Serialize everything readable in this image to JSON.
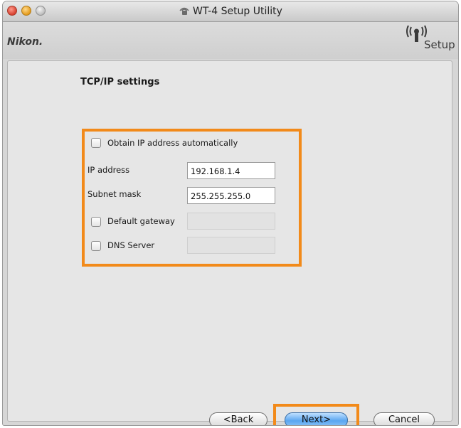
{
  "window": {
    "title": "WT-4 Setup Utility"
  },
  "brand": {
    "logo": "Nikon.",
    "setup_logo": "Setup"
  },
  "page": {
    "heading": "TCP/IP settings"
  },
  "form": {
    "obtain_auto_label": "Obtain IP address automatically",
    "ip_label": "IP address",
    "ip_value": "192.168.1.4",
    "subnet_label": "Subnet mask",
    "subnet_value": "255.255.255.0",
    "gateway_label": "Default gateway",
    "gateway_value": "",
    "dns_label": "DNS Server",
    "dns_value": ""
  },
  "buttons": {
    "back": "<Back",
    "next": "Next>",
    "cancel": "Cancel"
  },
  "colors": {
    "highlight": "#f28a1a",
    "primary_button": "#5aa6f0"
  }
}
